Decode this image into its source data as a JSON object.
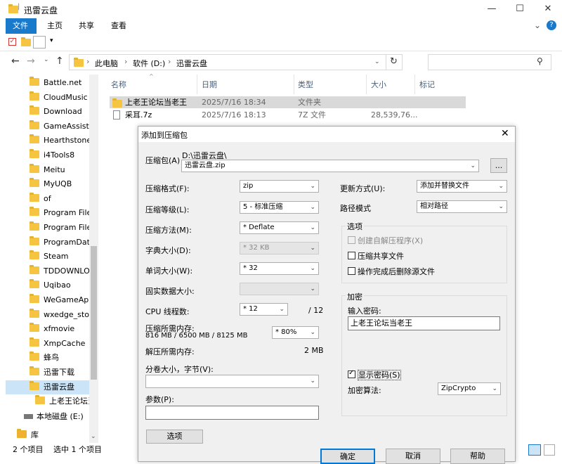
{
  "window": {
    "title": "迅雷云盘",
    "minimize": "—",
    "maximize": "☐",
    "close": "✕"
  },
  "ribbon": {
    "tabs": [
      "文件",
      "主页",
      "共享",
      "查看"
    ],
    "expand": "⌄",
    "help": "?"
  },
  "address": {
    "segments": [
      "此电脑",
      "软件 (D:)",
      "迅雷云盘"
    ],
    "separator": "›"
  },
  "sidebar": {
    "items": [
      "Battle.net",
      "CloudMusic",
      "Download",
      "GameAssistar",
      "Hearthstone",
      "i4Tools8",
      "Meitu",
      "MyUQB",
      "of",
      "Program Files",
      "Program Files",
      "ProgramData",
      "Steam",
      "TDDOWNLOA",
      "Uqibao",
      "WeGameApp",
      "wxedge_stora",
      "xfmovie",
      "XmpCache",
      "蜂鸟",
      "迅雷下载",
      "迅雷云盘"
    ],
    "child": "上老王论坛当",
    "drive": "本地磁盘 (E:)",
    "library": "库"
  },
  "filelist": {
    "columns": [
      "名称",
      "日期",
      "类型",
      "大小",
      "标记"
    ],
    "rows": [
      {
        "name": "上老王论坛当老王",
        "date": "2025/7/16 18:34",
        "type": "文件夹",
        "size": ""
      },
      {
        "name": "采耳.7z",
        "date": "2025/7/16 18:13",
        "type": "7Z 文件",
        "size": "28,539,76..."
      }
    ]
  },
  "status": {
    "count": "2 个项目",
    "selected": "选中 1 个项目"
  },
  "dialog": {
    "title": "添加到压缩包",
    "archive_label": "压缩包(A)",
    "archive_path": "D:\\迅雷云盘\\",
    "archive_name": "迅雷云盘.zip",
    "browse": "...",
    "format_label": "压缩格式(F):",
    "format_value": "zip",
    "level_label": "压缩等级(L):",
    "level_value": "5 - 标准压缩",
    "method_label": "压缩方法(M):",
    "method_value": "* Deflate",
    "dict_label": "字典大小(D):",
    "dict_value": "* 32 KB",
    "word_label": "单词大小(W):",
    "word_value": "* 32",
    "solid_label": "固实数据大小:",
    "solid_value": "",
    "cpu_label": "CPU 线程数:",
    "cpu_value": "* 12",
    "cpu_max": "/ 12",
    "mem_label": "压缩所需内存:",
    "mem_detail": "816 MB / 6500 MB / 8125 MB",
    "mem_value": "* 80%",
    "decomp_label": "解压所需内存:",
    "decomp_value": "2 MB",
    "split_label": "分卷大小，字节(V):",
    "split_value": "",
    "params_label": "参数(P):",
    "params_value": "",
    "options_button": "选项",
    "update_label": "更新方式(U):",
    "update_value": "添加并替换文件",
    "path_label": "路径模式",
    "path_value": "相对路径",
    "options_group": "选项",
    "opt_sfx": "创建自解压程序(X)",
    "opt_shared": "压缩共享文件",
    "opt_delete": "操作完成后删除源文件",
    "encrypt_group": "加密",
    "password_label": "输入密码:",
    "password_value": "上老王论坛当老王",
    "show_password": "显示密码(S)",
    "enc_method_label": "加密算法:",
    "enc_method_value": "ZipCrypto",
    "ok": "确定",
    "cancel": "取消",
    "help": "帮助"
  }
}
